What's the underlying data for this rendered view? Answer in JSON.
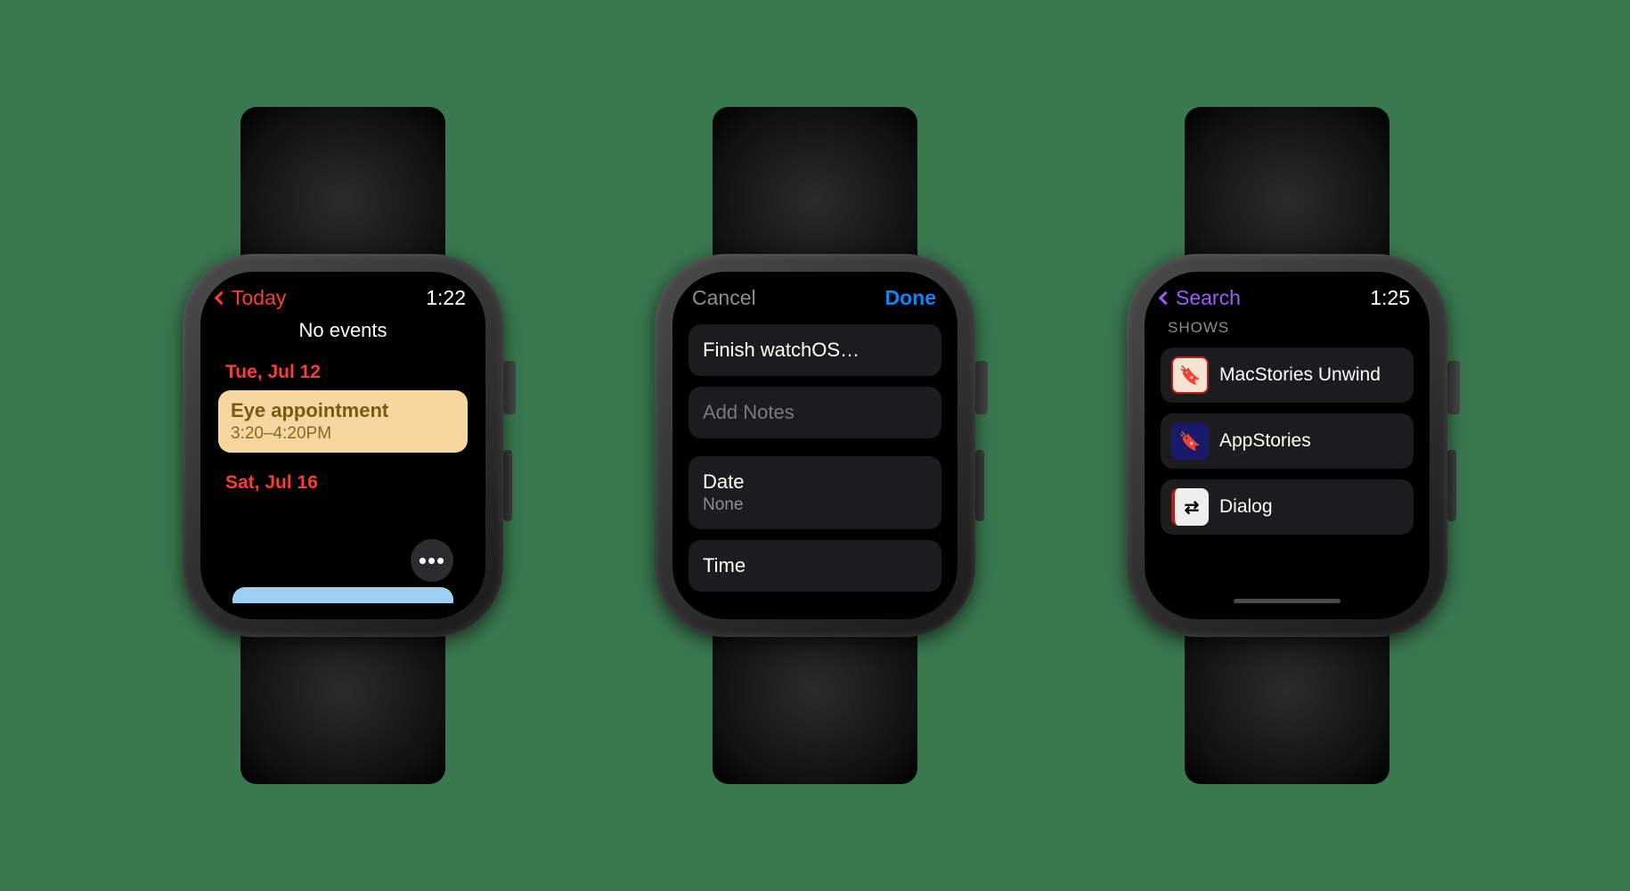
{
  "watch1": {
    "back_label": "Today",
    "time": "1:22",
    "no_events": "No events",
    "dates": [
      {
        "label": "Tue, Jul 12",
        "events": [
          {
            "title": "Eye appointment",
            "time": "3:20–4:20PM"
          }
        ]
      },
      {
        "label": "Sat, Jul 16",
        "events": []
      }
    ],
    "more": "•••"
  },
  "watch2": {
    "cancel": "Cancel",
    "done": "Done",
    "title_field": "Finish watchOS…",
    "notes_placeholder": "Add Notes",
    "date_label": "Date",
    "date_value": "None",
    "time_label": "Time"
  },
  "watch3": {
    "back_label": "Search",
    "time": "1:25",
    "section": "SHOWS",
    "shows": [
      {
        "name": "MacStories Unwind"
      },
      {
        "name": "AppStories"
      },
      {
        "name": "Dialog"
      }
    ]
  }
}
